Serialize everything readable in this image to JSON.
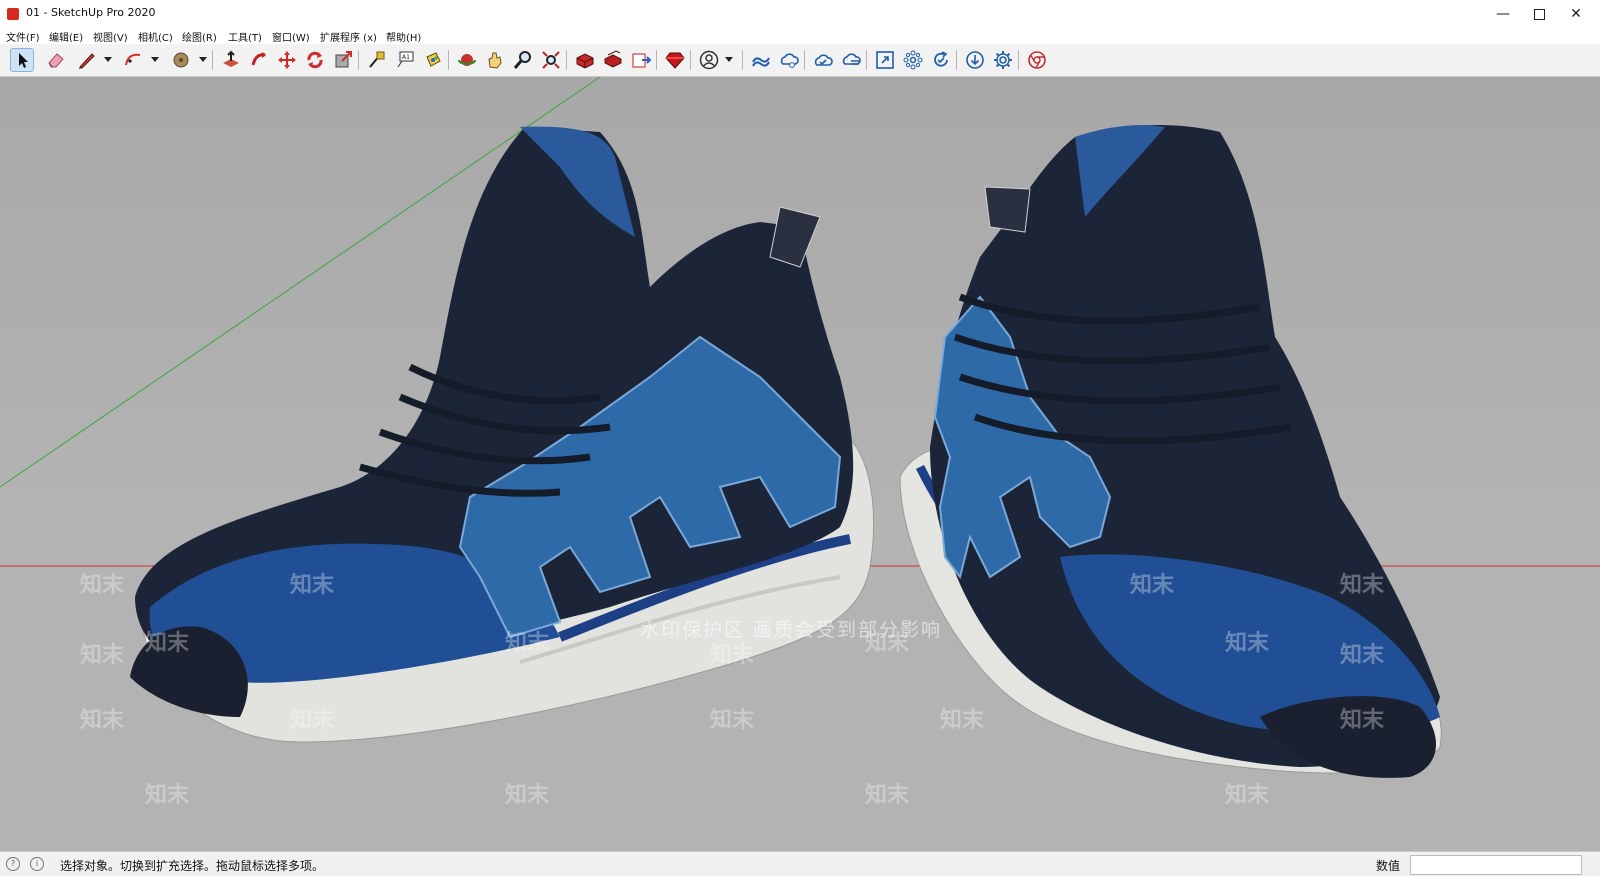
{
  "window": {
    "title": "01 - SketchUp Pro 2020",
    "minimize_icon": "minimize-icon",
    "maximize_icon": "maximize-icon",
    "close_icon": "close-icon"
  },
  "menu": [
    {
      "label": "文件(F)"
    },
    {
      "label": "编辑(E)"
    },
    {
      "label": "视图(V)"
    },
    {
      "label": "相机(C)"
    },
    {
      "label": "绘图(R)"
    },
    {
      "label": "工具(T)"
    },
    {
      "label": "窗口(W)"
    },
    {
      "label": "扩展程序 (x)"
    },
    {
      "label": "帮助(H)"
    }
  ],
  "toolbar": {
    "tools": [
      "select-icon",
      "eraser-icon",
      "pencil-icon",
      "arc-icon",
      "paint-bucket-icon",
      "push-pull-icon",
      "follow-me-icon",
      "move-icon",
      "rotate-icon",
      "scale-icon",
      "tape-measure-icon",
      "text-icon",
      "paint-icon",
      "orbit-icon",
      "pan-icon",
      "zoom-icon",
      "zoom-extents-icon",
      "warehouse-icon",
      "extension-warehouse-icon",
      "layout-icon",
      "ruby-icon",
      "account-icon",
      "cloud-icon",
      "cloud-share-icon",
      "cloud-sync-icon",
      "cloud-upload-icon",
      "window-icon",
      "components-icon",
      "refresh-icon",
      "download-icon",
      "settings-icon",
      "chrome-icon"
    ]
  },
  "viewport": {
    "scene": "3D model of a pair of blue and navy running shoes",
    "watermark_banner": "水印保护区  画质会受到部分影响",
    "watermark_text": "知末"
  },
  "status": {
    "message": "选择对象。切换到扩充选择。拖动鼠标选择多项。",
    "measure_label": "数值",
    "measure_value": ""
  },
  "colors": {
    "navy_upper": "#1c2538",
    "blue_accent": "#2e6aa8",
    "sole_white": "#e6e6e2",
    "viewport_bg": "#aeaeae",
    "axis_green": "#3ba83b",
    "axis_red": "#d03030"
  }
}
